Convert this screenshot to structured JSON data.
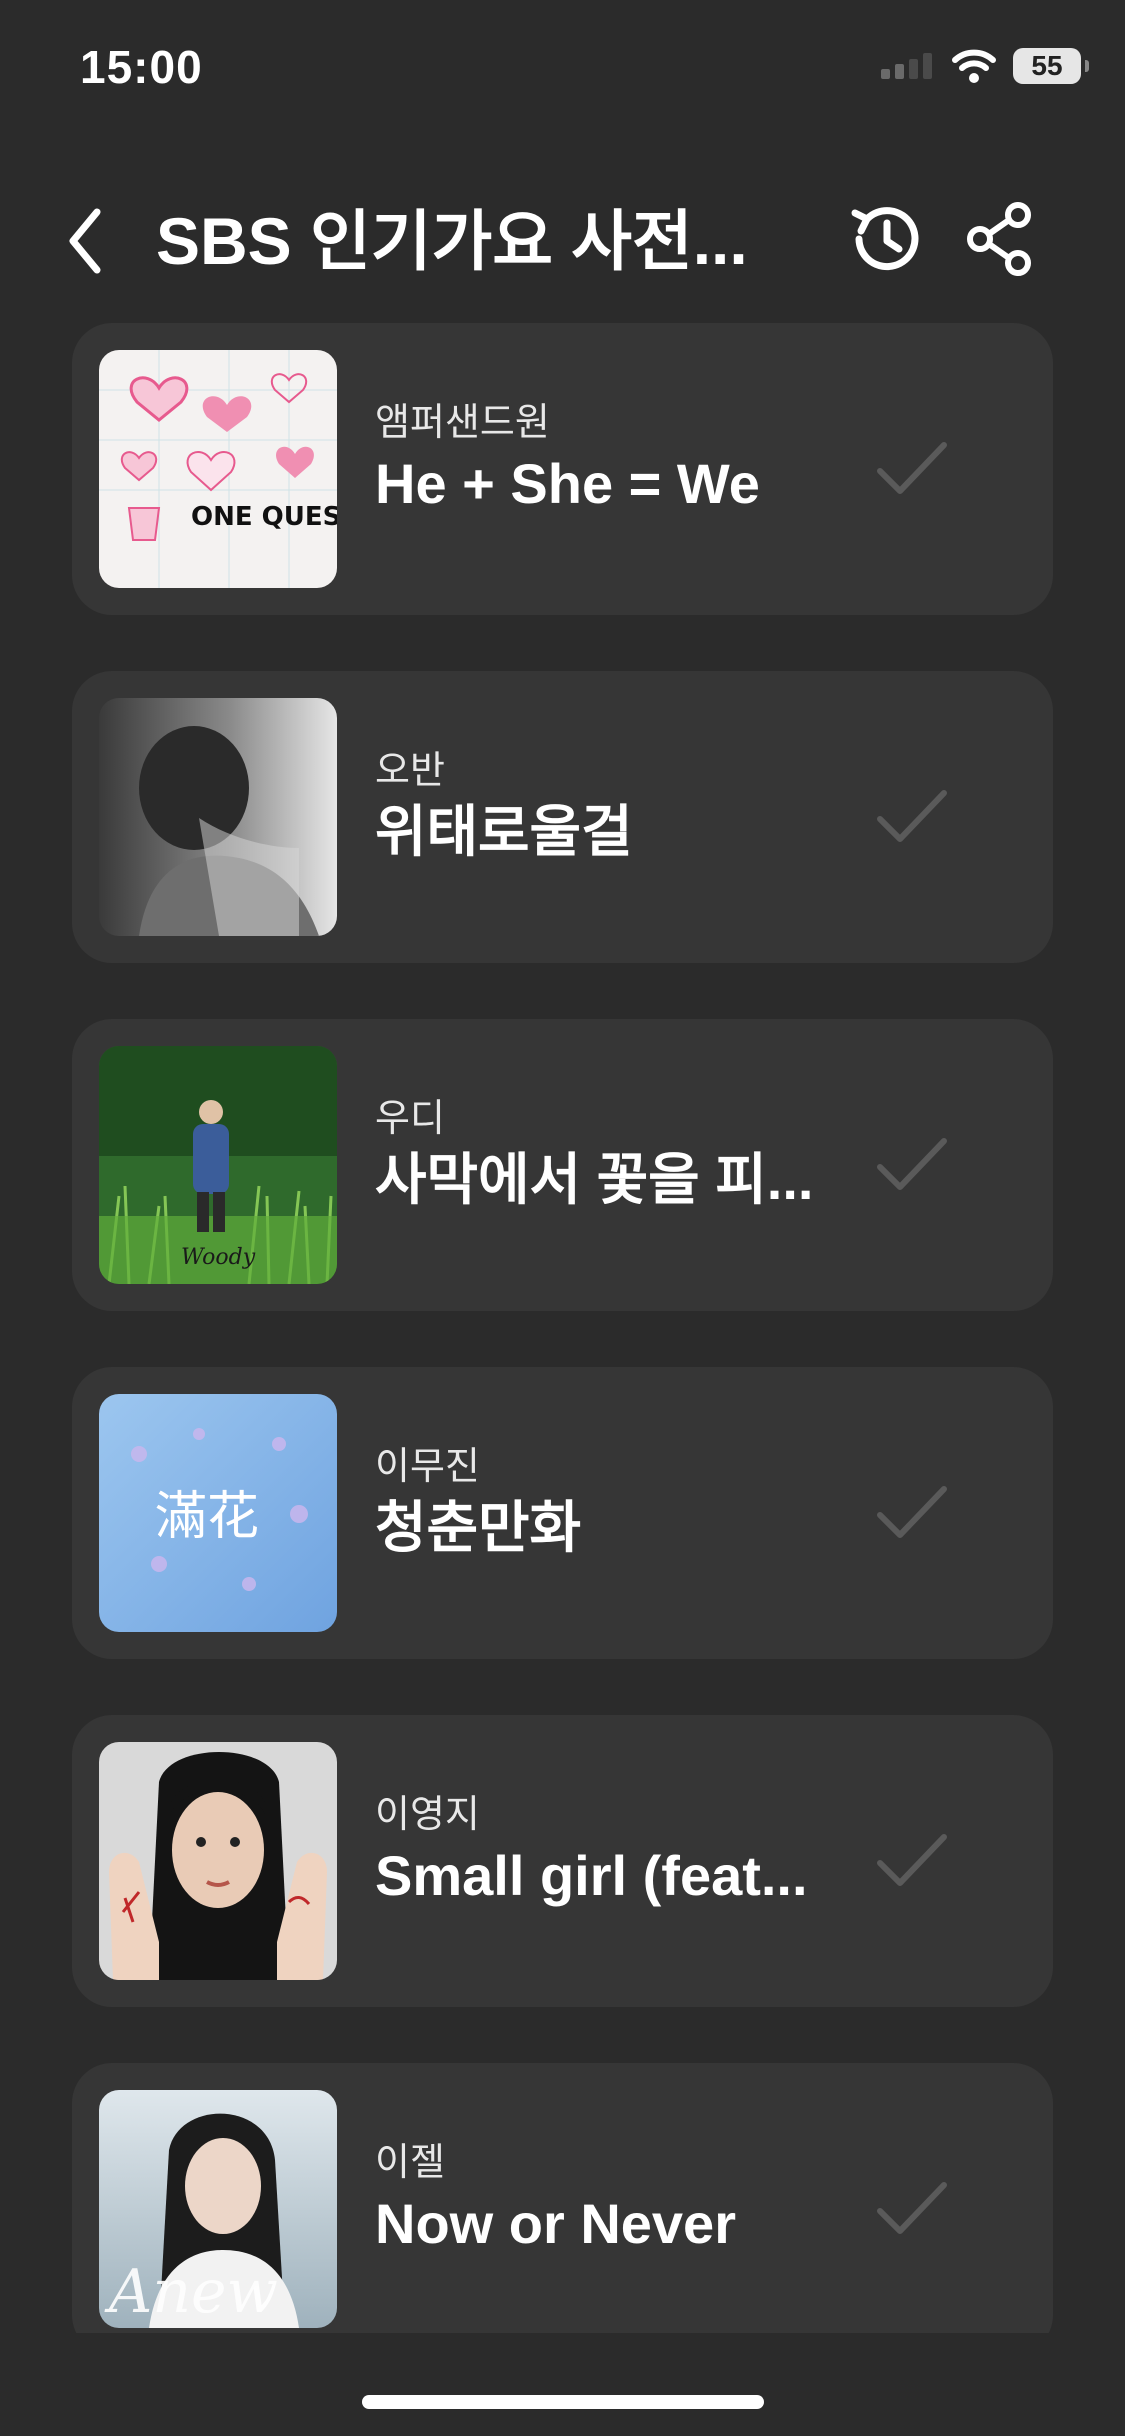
{
  "status_bar": {
    "time": "15:00",
    "battery": "55"
  },
  "header": {
    "title": "SBS 인기가요 사전..."
  },
  "songs": [
    {
      "artist": "앰퍼샌드원",
      "title": "He + She = We"
    },
    {
      "artist": "오반",
      "title": "위태로울걸"
    },
    {
      "artist": "우디",
      "title": "사막에서 꽃을 피..."
    },
    {
      "artist": "이무진",
      "title": "청춘만화"
    },
    {
      "artist": "이영지",
      "title": "Small girl (feat..."
    },
    {
      "artist": "이젤",
      "title": "Now or Never"
    }
  ],
  "album_art_text": {
    "song_0": "ONE QUESTION",
    "song_2": "Woody",
    "song_3": "滿花",
    "song_5": "Anew"
  },
  "colors": {
    "background": "#2b2b2b",
    "card": "#363636",
    "check": "#5a5a5a",
    "text": "#ffffff"
  },
  "icons": {
    "back": "chevron-left-icon",
    "history": "history-icon",
    "share": "share-icon",
    "check": "check-icon",
    "wifi": "wifi-icon",
    "signal": "cellular-signal-icon"
  }
}
